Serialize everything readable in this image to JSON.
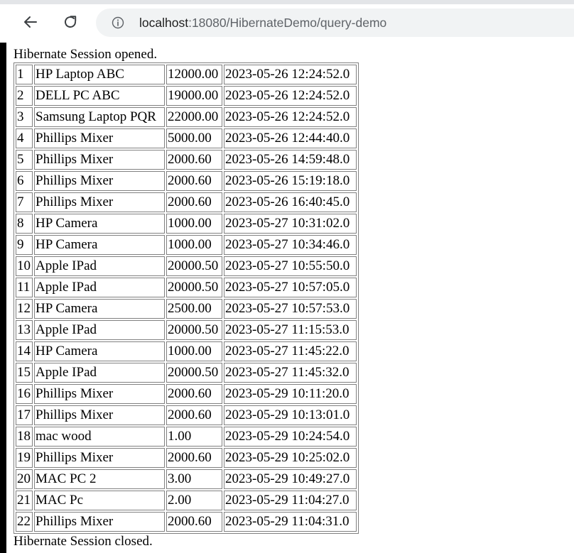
{
  "browser": {
    "url_host": "localhost",
    "url_rest": ":18080/HibernateDemo/query-demo"
  },
  "page": {
    "opened_text": "Hibernate Session opened.",
    "closed_text": "Hibernate Session closed.",
    "rows": [
      {
        "id": "1",
        "name": "HP Laptop ABC",
        "price": "12000.00",
        "date": "2023-05-26 12:24:52.0"
      },
      {
        "id": "2",
        "name": "DELL PC ABC",
        "price": "19000.00",
        "date": "2023-05-26 12:24:52.0"
      },
      {
        "id": "3",
        "name": "Samsung Laptop PQR",
        "price": "22000.00",
        "date": "2023-05-26 12:24:52.0"
      },
      {
        "id": "4",
        "name": "Phillips Mixer",
        "price": "5000.00",
        "date": "2023-05-26 12:44:40.0"
      },
      {
        "id": "5",
        "name": "Phillips Mixer",
        "price": "2000.60",
        "date": "2023-05-26 14:59:48.0"
      },
      {
        "id": "6",
        "name": "Phillips Mixer",
        "price": "2000.60",
        "date": "2023-05-26 15:19:18.0"
      },
      {
        "id": "7",
        "name": "Phillips Mixer",
        "price": "2000.60",
        "date": "2023-05-26 16:40:45.0"
      },
      {
        "id": "8",
        "name": "HP Camera",
        "price": "1000.00",
        "date": "2023-05-27 10:31:02.0"
      },
      {
        "id": "9",
        "name": "HP Camera",
        "price": "1000.00",
        "date": "2023-05-27 10:34:46.0"
      },
      {
        "id": "10",
        "name": "Apple IPad",
        "price": "20000.50",
        "date": "2023-05-27 10:55:50.0"
      },
      {
        "id": "11",
        "name": "Apple IPad",
        "price": "20000.50",
        "date": "2023-05-27 10:57:05.0"
      },
      {
        "id": "12",
        "name": "HP Camera",
        "price": "2500.00",
        "date": "2023-05-27 10:57:53.0"
      },
      {
        "id": "13",
        "name": "Apple IPad",
        "price": "20000.50",
        "date": "2023-05-27 11:15:53.0"
      },
      {
        "id": "14",
        "name": "HP Camera",
        "price": "1000.00",
        "date": "2023-05-27 11:45:22.0"
      },
      {
        "id": "15",
        "name": "Apple IPad",
        "price": "20000.50",
        "date": "2023-05-27 11:45:32.0"
      },
      {
        "id": "16",
        "name": "Phillips Mixer",
        "price": "2000.60",
        "date": "2023-05-29 10:11:20.0"
      },
      {
        "id": "17",
        "name": "Phillips Mixer",
        "price": "2000.60",
        "date": "2023-05-29 10:13:01.0"
      },
      {
        "id": "18",
        "name": "mac wood",
        "price": "1.00",
        "date": "2023-05-29 10:24:54.0"
      },
      {
        "id": "19",
        "name": "Phillips Mixer",
        "price": "2000.60",
        "date": "2023-05-29 10:25:02.0"
      },
      {
        "id": "20",
        "name": "MAC PC 2",
        "price": "3.00",
        "date": "2023-05-29 10:49:27.0"
      },
      {
        "id": "21",
        "name": "MAC Pc",
        "price": "2.00",
        "date": "2023-05-29 11:04:27.0"
      },
      {
        "id": "22",
        "name": "Phillips Mixer",
        "price": "2000.60",
        "date": "2023-05-29 11:04:31.0"
      }
    ]
  },
  "icons": {
    "back": "arrow-left-icon",
    "reload": "reload-icon",
    "info": "info-icon"
  },
  "colors": {
    "address_bar_bg": "#f1f3f4",
    "url_host": "#1f1f1f",
    "url_path": "#5f6368",
    "table_border": "#808080"
  }
}
